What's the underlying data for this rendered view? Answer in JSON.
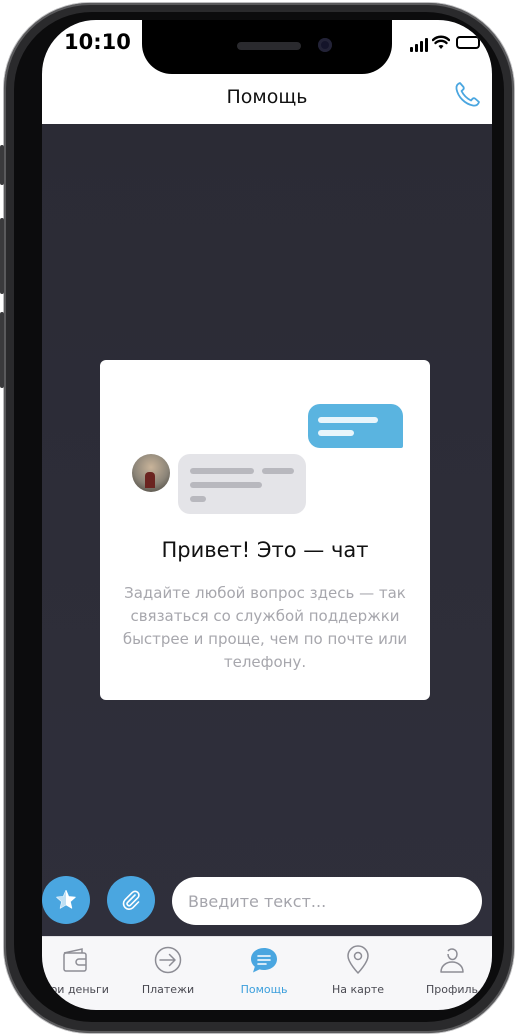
{
  "status_bar": {
    "time": "10:10"
  },
  "header": {
    "title": "Помощь",
    "call_icon": "phone-icon"
  },
  "welcome_card": {
    "title": "Привет! Это — чат",
    "text": "Задайте любой вопрос здесь — так связаться со службой поддержки быстрее и проще, чем по почте или телефону."
  },
  "composer": {
    "favorites_icon": "star-icon",
    "attach_icon": "paperclip-icon",
    "placeholder": "Введите текст..."
  },
  "tabs": [
    {
      "label": "Мои деньги",
      "icon": "wallet-icon"
    },
    {
      "label": "Платежи",
      "icon": "arrow-circle-icon"
    },
    {
      "label": "Помощь",
      "icon": "chat-bubble-icon",
      "active": true
    },
    {
      "label": "На карте",
      "icon": "map-pin-icon"
    },
    {
      "label": "Профиль",
      "icon": "profile-icon"
    }
  ],
  "colors": {
    "accent": "#4aa6e0",
    "chat_background": "#2c2c37",
    "active_tab": "#3c9fdc"
  }
}
